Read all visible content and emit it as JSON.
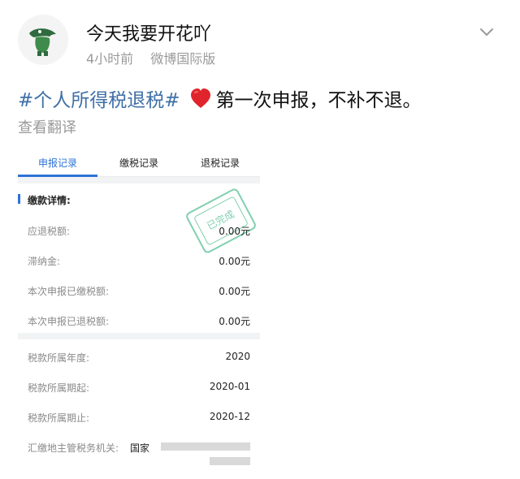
{
  "post": {
    "username": "今天我要开花吖",
    "time": "4小时前",
    "source": "微博国际版",
    "hashtag": "#个人所得税退税#",
    "text": "第一次申报，不补不退。",
    "translate": "查看翻译"
  },
  "card": {
    "tabs": [
      "申报记录",
      "缴税记录",
      "退税记录"
    ],
    "active_tab": "申报记录",
    "section_title": "缴款详情:",
    "stamp_text": "已完成",
    "rows_top": [
      {
        "label": "应退税额:",
        "value": "0.00元"
      },
      {
        "label": "滞纳金:",
        "value": "0.00元"
      },
      {
        "label": "本次申报已缴税额:",
        "value": "0.00元"
      },
      {
        "label": "本次申报已退税额:",
        "value": "0.00元"
      }
    ],
    "rows_bottom": [
      {
        "label": "税款所属年度:",
        "value": "2020"
      },
      {
        "label": "税款所属期起:",
        "value": "2020-01"
      },
      {
        "label": "税款所属期止:",
        "value": "2020-12"
      },
      {
        "label": "汇缴地主管税务机关:",
        "value": "国家"
      }
    ]
  },
  "colors": {
    "accent": "#2f73d6",
    "hashtag": "#3f6fa6",
    "stamp": "#6cc7a2",
    "heart": "#e0242b"
  },
  "icons": {
    "avatar": "crocodile-avatar",
    "more": "chevron-down-icon",
    "heart": "heart-icon"
  }
}
